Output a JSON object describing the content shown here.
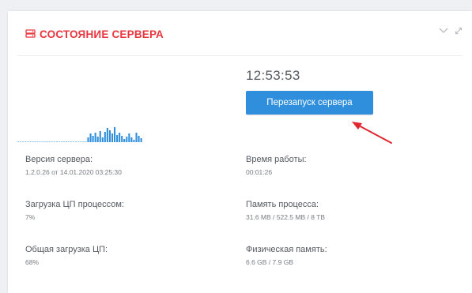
{
  "panel": {
    "title": "СОСТОЯНИЕ СЕРВЕРА",
    "title_icon": "server-icon",
    "accent_color": "#e8363e"
  },
  "clock": {
    "time": "12:53:53"
  },
  "restart_button": {
    "label": "Перезапуск сервера",
    "color": "#2f8fdc"
  },
  "cpu_sparkline": {
    "color": "#2f8fdc",
    "values": [
      0,
      0,
      0,
      0,
      0,
      0,
      0,
      0,
      0,
      0,
      0,
      0,
      0,
      0,
      0,
      0,
      0,
      0,
      0,
      0,
      0,
      0,
      0,
      0,
      0,
      0,
      0,
      0,
      0,
      0.3,
      0.55,
      0.4,
      0.6,
      0.35,
      0.7,
      0.3,
      0.65,
      0.9,
      0.75,
      0.55,
      0.95,
      0.45,
      0.6,
      0.4,
      0.2,
      0.35,
      0.55,
      0.3,
      0.15,
      0.6,
      0.4,
      0.25
    ]
  },
  "stats": {
    "server_version_label": "Версия сервера:",
    "server_version_value": "1.2.0.26 от 14.01.2020 03:25:30",
    "uptime_label": "Время работы:",
    "uptime_value": "00:01:26",
    "process_cpu_label": "Загрузка ЦП процессом:",
    "process_cpu_value": "7%",
    "process_memory_label": "Память процесса:",
    "process_memory_value": "31.6 MB / 522.5 MB / 8 TB",
    "total_cpu_label": "Общая загрузка ЦП:",
    "total_cpu_value": "68%",
    "physical_memory_label": "Физическая память:",
    "physical_memory_value": "6.6 GB / 7.9 GB"
  }
}
